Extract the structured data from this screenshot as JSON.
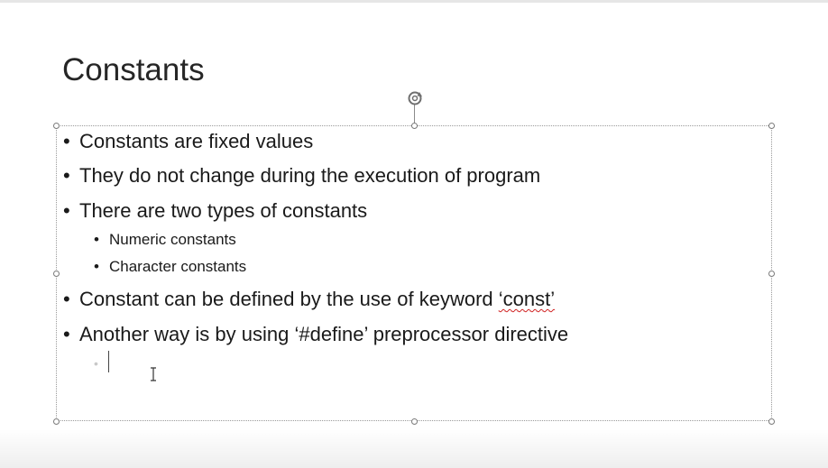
{
  "slide": {
    "title": "Constants",
    "bullets": [
      {
        "level": 1,
        "text": "Constants are fixed values"
      },
      {
        "level": 1,
        "text": "They do not change during the execution of program"
      },
      {
        "level": 1,
        "text": "There are two types of constants"
      },
      {
        "level": 2,
        "text": "Numeric constants"
      },
      {
        "level": 2,
        "text": "Character constants"
      },
      {
        "level": 1,
        "text_before": "Constant can be defined by the use of keyword ",
        "keyword": "‘const’"
      },
      {
        "level": 1,
        "text": "Another way is by using ‘#define’ preprocessor directive"
      }
    ],
    "bullet_char": "•",
    "empty_bullet_char": "•"
  },
  "icons": {
    "rotate_handle": "rotate-icon",
    "text_cursor": "ibeam-cursor-icon"
  },
  "colors": {
    "text": "#1a1a1a",
    "spellcheck_underline": "#d02020",
    "selection_border": "#9a9a9a"
  }
}
